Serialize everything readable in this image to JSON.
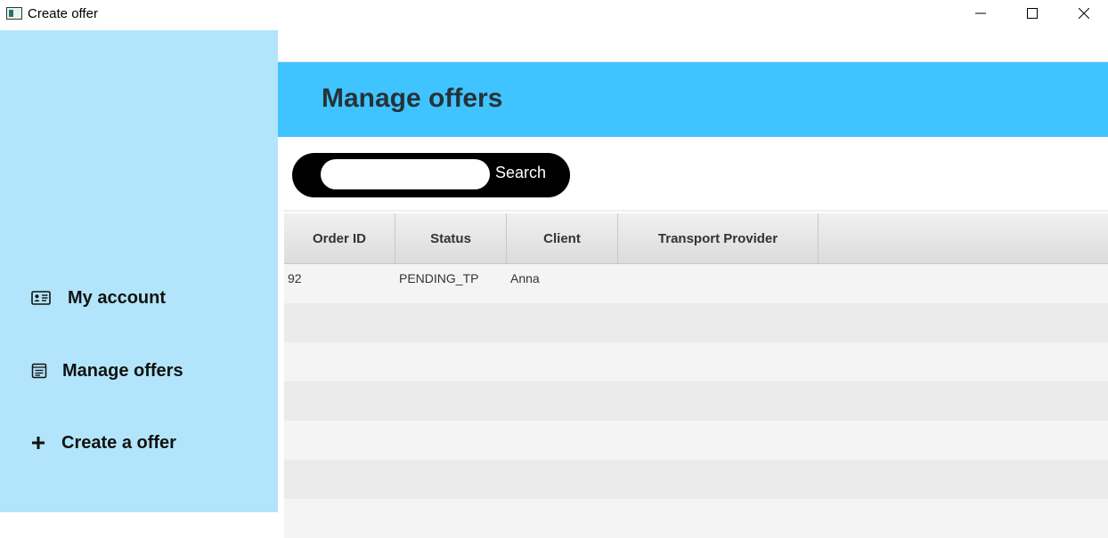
{
  "window": {
    "title": "Create offer",
    "icon": "app-window-icon",
    "controls": [
      "minimize-icon",
      "maximize-icon",
      "close-icon"
    ]
  },
  "sidebar": {
    "background": "#b2e5fb",
    "items": [
      {
        "label": "My account",
        "icon": "id-card-icon"
      },
      {
        "label": "Manage offers",
        "icon": "list-icon"
      },
      {
        "label": "Create a offer",
        "icon": "plus-icon"
      }
    ]
  },
  "header": {
    "title": "Manage offers",
    "background": "#40c4ff"
  },
  "search": {
    "value": "",
    "placeholder": "",
    "button_label": "Search"
  },
  "table": {
    "columns": [
      "Order ID",
      "Status",
      "Client",
      "Transport Provider"
    ],
    "rows": [
      {
        "order_id": "92",
        "status": "PENDING_TP",
        "client": "Anna",
        "transport_provider": ""
      }
    ]
  }
}
